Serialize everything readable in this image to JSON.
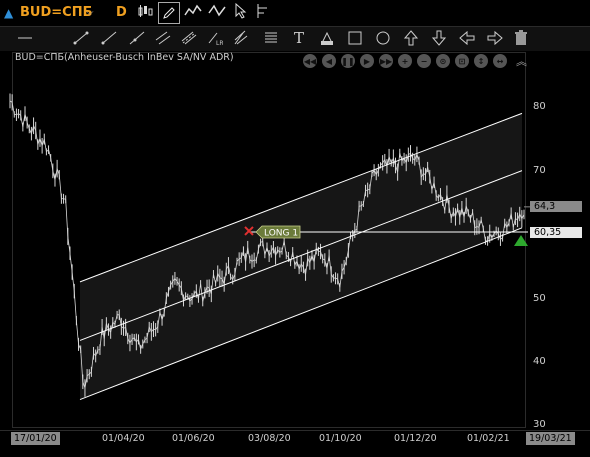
{
  "topbar": {
    "symbol": "BUD=СПБ",
    "timeframe": "D",
    "icons": [
      "candlestick-icon",
      "pencil-icon",
      "series-icon",
      "wave-icon",
      "cursor-icon",
      "order-ladder-icon"
    ]
  },
  "drawbar": {
    "tools": [
      "horizontal-line-icon",
      "trend-line-icon",
      "ray-line-icon",
      "extended-line-icon",
      "parallel-channel-icon",
      "regression-channel-icon",
      "fibonacci-icon",
      "pitchfork-icon",
      "fan-icon",
      "levels-icon",
      "text-icon",
      "price-label-icon",
      "rectangle-icon",
      "ellipse-icon",
      "arrow-up-icon",
      "arrow-down-icon",
      "arrow-left-icon",
      "arrow-right-icon",
      "trash-icon"
    ],
    "text_tool": "T"
  },
  "chart": {
    "title": "BUD=СПБ(Anheuser-Busch InBev SA/NV ADR)",
    "y_ticks": [
      "80",
      "70",
      "60",
      "50",
      "40",
      "30"
    ],
    "x_first": "17/01/20",
    "x_ticks": [
      "01/04/20",
      "01/06/20",
      "03/08/20",
      "01/10/20",
      "01/12/20",
      "01/02/21"
    ],
    "x_last": "19/03/21",
    "last_price": "64,3",
    "position_price": "60,35",
    "position_label": "LONG 1",
    "colors": {
      "price": "#d8d8d8",
      "channel": "#ffffff",
      "position_line": "#ffffff",
      "long_tag": "#6b7b3a",
      "marker_x": "#e03030",
      "buy_arrow": "#2ea82e",
      "price_box": "#8a8a8a"
    }
  },
  "chart_data": {
    "type": "line",
    "title": "BUD=СПБ(Anheuser-Busch InBev SA/NV ADR)",
    "ylim": [
      30,
      85
    ],
    "x": [
      "17/01/20",
      "01/02/20",
      "15/02/20",
      "01/03/20",
      "15/03/20",
      "01/04/20",
      "15/04/20",
      "01/05/20",
      "15/05/20",
      "01/06/20",
      "15/06/20",
      "01/07/20",
      "15/07/20",
      "03/08/20",
      "15/08/20",
      "01/09/20",
      "15/09/20",
      "01/10/20",
      "15/10/20",
      "01/11/20",
      "15/11/20",
      "01/12/20",
      "15/12/20",
      "01/01/21",
      "15/01/21",
      "01/02/21",
      "15/02/21",
      "01/03/21",
      "19/03/21"
    ],
    "series": [
      {
        "values": [
          81,
          77,
          74,
          65,
          36,
          44,
          47,
          42,
          46,
          52,
          50,
          52,
          54,
          57,
          58,
          58,
          55,
          57,
          53,
          63,
          70,
          71,
          72,
          68,
          64,
          63,
          60,
          61,
          64.3
        ]
      }
    ],
    "position_price": 60.35,
    "last_price": 64.3
  }
}
